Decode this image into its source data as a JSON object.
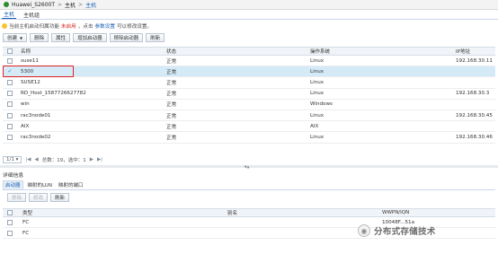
{
  "breadcrumb": {
    "root": "Huawei_S2600T",
    "level1": "主机",
    "level2": "主机",
    "sep": ">"
  },
  "tabs": [
    "主机",
    "主机组"
  ],
  "tip": {
    "prefix": "当前主机启动归属功能",
    "status": "未启用",
    "middle": "，点击",
    "link": "参数设置",
    "suffix": "可以修改设置。"
  },
  "toolbar": {
    "create": "创建",
    "delete": "删除",
    "properties": "属性",
    "add_initiator": "增加启动器",
    "remove_initiator": "移除启动器",
    "refresh": "刷新"
  },
  "columns": {
    "name": "名称",
    "status": "状态",
    "os": "操作系统",
    "ip": "IP地址"
  },
  "hosts": [
    {
      "name": "suse11",
      "status": "正常",
      "os": "Linux",
      "ip": "192.168.30.11",
      "checked": false
    },
    {
      "name": "5300",
      "status": "正常",
      "os": "Linux",
      "ip": "",
      "checked": true
    },
    {
      "name": "SUSE12",
      "status": "正常",
      "os": "Linux",
      "ip": "",
      "checked": false
    },
    {
      "name": "RD_Host_1587726627782",
      "status": "正常",
      "os": "Linux",
      "ip": "192.168.30.3",
      "checked": false
    },
    {
      "name": "win",
      "status": "正常",
      "os": "Windows",
      "ip": "",
      "checked": false
    },
    {
      "name": "rac3node01",
      "status": "正常",
      "os": "Linux",
      "ip": "192.168.30.45",
      "checked": false
    },
    {
      "name": "AIX",
      "status": "正常",
      "os": "AIX",
      "ip": "",
      "checked": false
    },
    {
      "name": "rac3node02",
      "status": "正常",
      "os": "Linux",
      "ip": "192.168.30.46",
      "checked": false
    }
  ],
  "pager": {
    "page": "1/1",
    "summary": "总数：19，选中：1",
    "first": "|◀",
    "prev": "◀",
    "next": "▶",
    "last": "▶|"
  },
  "detail": {
    "title": "详细信息",
    "tabs": [
      "启动器",
      "映射的LUN",
      "映射的端口"
    ],
    "buttons": {
      "remove": "移除",
      "modify": "修改",
      "refresh": "刷新"
    },
    "columns": {
      "type": "类型",
      "alias": "别名",
      "wwpn": "WWPN/IQN"
    },
    "rows": [
      {
        "type": "FC",
        "alias": "",
        "wwpn": "10048F...51a"
      },
      {
        "type": "FC",
        "alias": "",
        "wwpn": ""
      }
    ]
  },
  "watermark": {
    "text": "分布式存储技术"
  },
  "icons": {
    "home": "home-icon",
    "tip": "lightbulb-icon",
    "check": "checkmark-icon",
    "watermark": "wechat-icon"
  },
  "colors": {
    "accent": "#1a5fb4",
    "warning": "#d9261c",
    "selected_row": "#d5eaf7",
    "highlight_box": "#e02020"
  }
}
